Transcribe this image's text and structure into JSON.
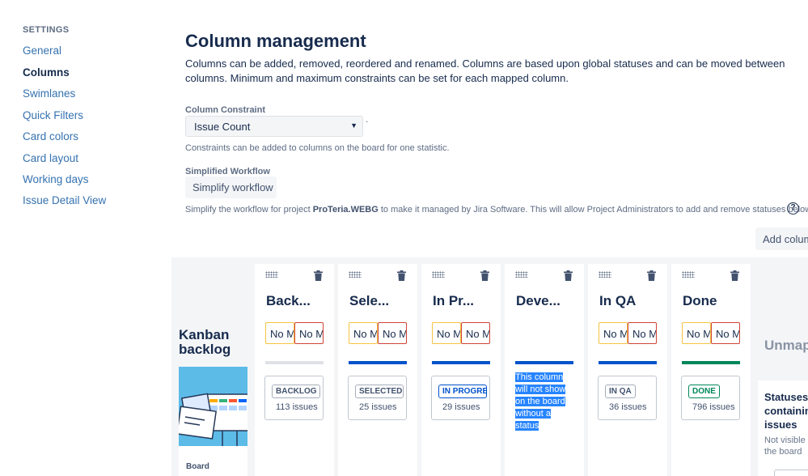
{
  "sidebar": {
    "heading": "SETTINGS",
    "items": [
      {
        "label": "General",
        "active": false
      },
      {
        "label": "Columns",
        "active": true
      },
      {
        "label": "Swimlanes",
        "active": false
      },
      {
        "label": "Quick Filters",
        "active": false
      },
      {
        "label": "Card colors",
        "active": false
      },
      {
        "label": "Card layout",
        "active": false
      },
      {
        "label": "Working days",
        "active": false
      },
      {
        "label": "Issue Detail View",
        "active": false
      }
    ]
  },
  "main": {
    "title": "Column management",
    "description": "Columns can be added, removed, reordered and renamed. Columns are based upon global statuses and can be moved between columns. Minimum and maximum constraints can be set for each mapped column.",
    "constraint": {
      "label": "Column Constraint",
      "selected": "Issue Count",
      "dot": ".",
      "help": "Constraints can be added to columns on the board for one statistic."
    },
    "workflow": {
      "label": "Simplified Workflow",
      "button": "Simplify workflow",
      "help_prefix": "Simplify the workflow for project ",
      "project": "ProTeria.WEBG",
      "help_suffix": " to make it managed by Jira Software. This will allow Project Administrators to add and remove statuses below.",
      "help_icon": "?"
    },
    "add_column_button": "Add column"
  },
  "board": {
    "kanban_title": "Kanban backlog",
    "kanban_card_label": "Board",
    "columns": [
      {
        "name": "Back...",
        "min": "No Min",
        "max": "No Max",
        "bar_color": "#dfe1e6",
        "status": "BACKLOG",
        "status_color": "#42526e",
        "count": "113 issues"
      },
      {
        "name": "Sele...",
        "min": "No Min",
        "max": "No Max",
        "bar_color": "#0052cc",
        "status": "SELECTED FOR DEVELOPMENT",
        "status_color": "#42526e",
        "count": "25 issues"
      },
      {
        "name": "In Pr...",
        "min": "No Min",
        "max": "No Max",
        "bar_color": "#0052cc",
        "status": "IN PROGRESS",
        "status_color": "#0052cc",
        "count": "29 issues"
      },
      {
        "name": "Deve...",
        "bar_color": "#0052cc",
        "note": "This column will not show on the board without a status"
      },
      {
        "name": "In QA",
        "min": "No Min",
        "max": "No Max",
        "bar_color": "#0052cc",
        "status": "IN QA",
        "status_color": "#42526e",
        "count": "36 issues"
      },
      {
        "name": "Done",
        "min": "No Min",
        "max": "No Max",
        "bar_color": "#00875a",
        "status": "DONE",
        "status_color": "#00875a",
        "count": "796 issues"
      }
    ],
    "unmapped": {
      "title": "Unmapped",
      "panel_title": "Statuses containing issues",
      "panel_subtitle": "Not visible on the board"
    }
  },
  "colors": {
    "link": "#3572b0",
    "min_border": "#f6c342",
    "max_border": "#d04437",
    "selection": "#2684ff"
  }
}
